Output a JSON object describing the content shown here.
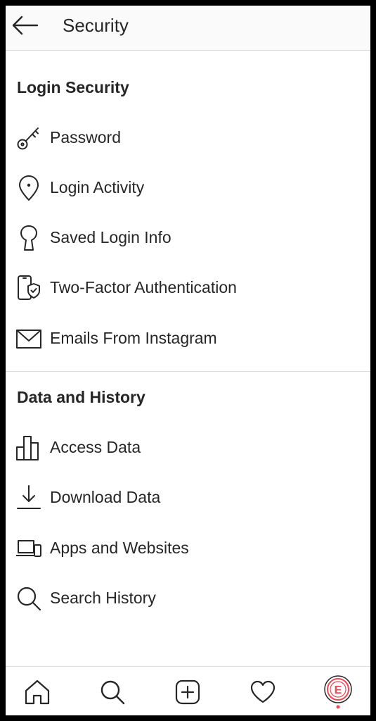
{
  "header": {
    "title": "Security"
  },
  "login_security": {
    "title": "Login Security",
    "items": [
      {
        "label": "Password",
        "icon": "key-icon"
      },
      {
        "label": "Login Activity",
        "icon": "location-pin-icon"
      },
      {
        "label": "Saved Login Info",
        "icon": "keyhole-icon"
      },
      {
        "label": "Two-Factor Authentication",
        "icon": "phone-shield-icon"
      },
      {
        "label": "Emails From Instagram",
        "icon": "envelope-icon"
      }
    ]
  },
  "data_history": {
    "title": "Data and History",
    "items": [
      {
        "label": "Access Data",
        "icon": "bar-chart-icon"
      },
      {
        "label": "Download Data",
        "icon": "download-icon"
      },
      {
        "label": "Apps and Websites",
        "icon": "devices-icon"
      },
      {
        "label": "Search History",
        "icon": "search-icon"
      }
    ]
  },
  "tabbar": {
    "tabs": [
      "home-icon",
      "search-icon",
      "new-post-icon",
      "heart-icon",
      "profile-avatar"
    ],
    "profile_initial": "E"
  },
  "colors": {
    "text": "#262626",
    "divider": "#dbdbdb",
    "accent": "#ed4956"
  }
}
